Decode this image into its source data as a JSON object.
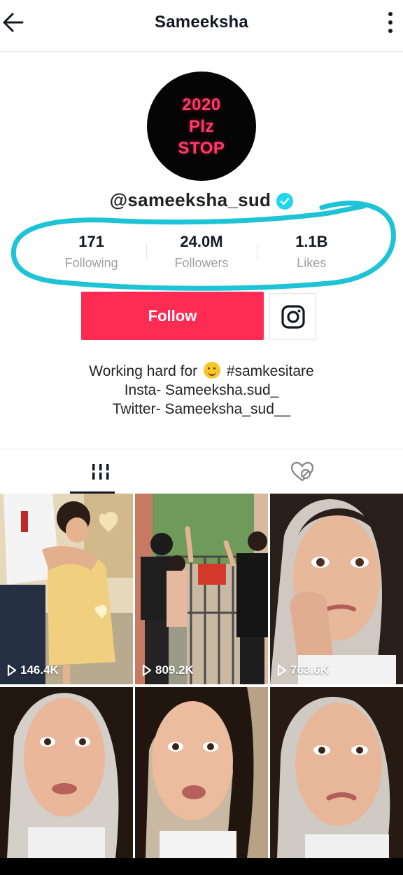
{
  "header": {
    "title": "Sameeksha",
    "back_icon": "arrow-left-icon",
    "more_icon": "vertical-dots-icon"
  },
  "profile": {
    "avatar_lines": [
      "2020",
      "Plz",
      "STOP"
    ],
    "username": "@sameeksha_sud",
    "verified": true,
    "stats": [
      {
        "value": "171",
        "label": "Following"
      },
      {
        "value": "24.0M",
        "label": "Followers"
      },
      {
        "value": "1.1B",
        "label": "Likes"
      }
    ],
    "follow_label": "Follow",
    "bio": {
      "line1_before": "Working hard for",
      "line1_after": "#samkesitare",
      "line2": "Insta- Sameeksha.sud_",
      "line3": "Twitter- Sameeksha_sud__"
    }
  },
  "tabs": [
    {
      "name": "videos",
      "icon": "grid-bars-icon",
      "active": true
    },
    {
      "name": "liked",
      "icon": "hidden-heart-icon",
      "active": false
    }
  ],
  "videos": [
    {
      "views": "146.4K"
    },
    {
      "views": "809.2K"
    },
    {
      "views": "763.6K"
    },
    {
      "views": ""
    },
    {
      "views": ""
    },
    {
      "views": ""
    }
  ],
  "colors": {
    "accent": "#fe2c55",
    "verified": "#20d5ec",
    "highlight": "#1ec4d6"
  }
}
